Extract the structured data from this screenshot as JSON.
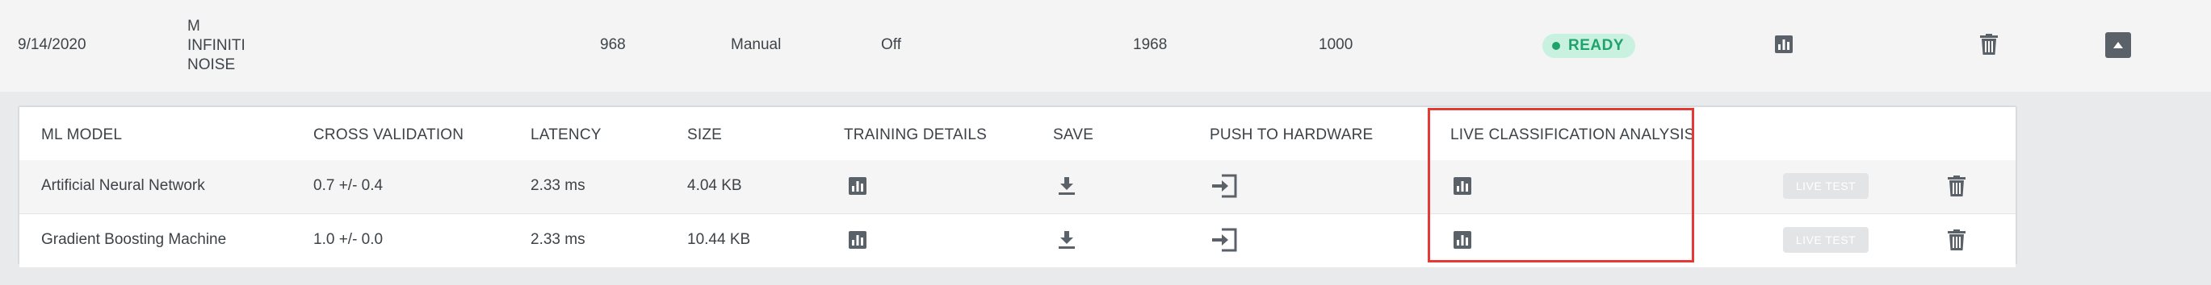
{
  "top_row": {
    "date": "9/14/2020",
    "name_lines": [
      "M",
      "INFINITI",
      "NOISE"
    ],
    "col_968": "968",
    "mode": "Manual",
    "toggle": "Off",
    "col_1968": "1968",
    "col_1000": "1000",
    "status": "READY",
    "status_color": "#1fa26b"
  },
  "table": {
    "headers": {
      "ml_model": "ML MODEL",
      "cross_validation": "CROSS VALIDATION",
      "latency": "LATENCY",
      "size": "SIZE",
      "training_details": "TRAINING DETAILS",
      "save": "SAVE",
      "push_to_hardware": "PUSH TO HARDWARE",
      "live_classification": "LIVE CLASSIFICATION ANALYSIS"
    },
    "rows": [
      {
        "model": "Artificial Neural Network",
        "cross_validation": "0.7 +/- 0.4",
        "latency": "2.33 ms",
        "size": "4.04 KB",
        "live_test": "LIVE TEST"
      },
      {
        "model": "Gradient Boosting Machine",
        "cross_validation": "1.0 +/- 0.0",
        "latency": "2.33 ms",
        "size": "10.44 KB",
        "live_test": "LIVE TEST"
      }
    ]
  },
  "icons": {
    "chart": "bar-chart-icon",
    "trash": "trash-icon",
    "download": "download-icon",
    "push": "push-to-hardware-icon",
    "expand": "chevron-up-icon"
  },
  "highlight_color": "#e53935"
}
